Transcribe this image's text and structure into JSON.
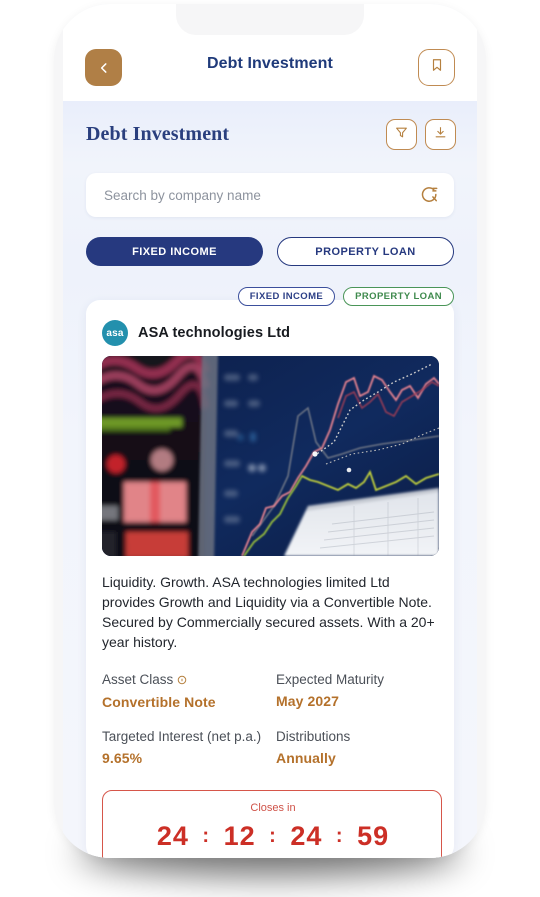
{
  "navbar": {
    "back_icon": "chevron-left-icon",
    "title": "Debt Investment",
    "bookmark_icon": "bookmark-icon"
  },
  "section": {
    "title": "Debt Investment",
    "filter_icon": "filter-icon",
    "download_icon": "download-icon"
  },
  "search": {
    "placeholder": "Search by company name",
    "value": "",
    "icon": "search-refresh-icon"
  },
  "tabs": [
    {
      "label": "FIXED INCOME",
      "active": true
    },
    {
      "label": "PROPERTY LOAN",
      "active": false
    }
  ],
  "card": {
    "badges": [
      {
        "label": "FIXED INCOME",
        "color": "#2c3f86"
      },
      {
        "label": "PROPERTY LOAN",
        "color": "#3f8a4d"
      }
    ],
    "avatar_text": "asa",
    "avatar_color": "#2390ad",
    "company_name": "ASA technologies Ltd",
    "image_alt": "financial-trading-charts-photo",
    "description": "Liquidity. Growth. ASA technologies limited Ltd provides Growth and Liquidity via a Convertible Note. Secured by Commercially secured assets. With a 20+ year history.",
    "details": [
      {
        "label": "Asset Class",
        "has_info_icon": true,
        "value": "Convertible Note"
      },
      {
        "label": "Expected Maturity",
        "has_info_icon": false,
        "value": "May 2027"
      },
      {
        "label": "Targeted Interest (net p.a.)",
        "has_info_icon": false,
        "value": "9.65%"
      },
      {
        "label": "Distributions",
        "has_info_icon": false,
        "value": "Annually"
      }
    ],
    "countdown": {
      "label": "Closes in",
      "days": "24",
      "hours": "12",
      "minutes": "24",
      "seconds": "59",
      "separator": ":"
    }
  },
  "colors": {
    "navy": "#26397f",
    "brown": "#b07f46",
    "accent_gold": "#b4712b",
    "danger_red": "#cc2f26",
    "green": "#3f8a4d"
  }
}
